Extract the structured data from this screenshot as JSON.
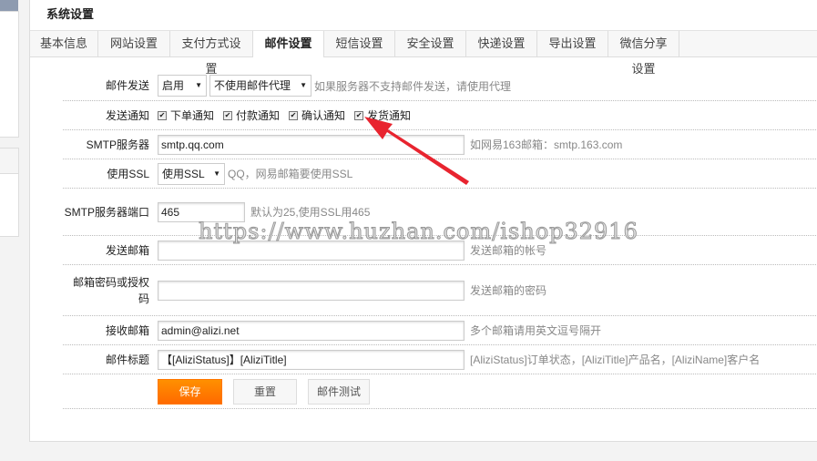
{
  "page_title": "系统设置",
  "tabs": [
    "基本信息",
    "网站设置",
    "支付方式设置",
    "邮件设置",
    "短信设置",
    "安全设置",
    "快递设置",
    "导出设置",
    "微信分享设置"
  ],
  "form": {
    "mail_send": {
      "label": "邮件发送",
      "status": "启用",
      "proxy": "不使用邮件代理",
      "hint": "如果服务器不支持邮件发送，请使用代理"
    },
    "notify": {
      "label": "发送通知",
      "options": [
        "下单通知",
        "付款通知",
        "确认通知",
        "发货通知"
      ]
    },
    "smtp_server": {
      "label": "SMTP服务器",
      "value": "smtp.qq.com",
      "hint": "如网易163邮箱：smtp.163.com"
    },
    "ssl": {
      "label": "使用SSL",
      "value": "使用SSL",
      "hint": "QQ，网易邮箱要使用SSL"
    },
    "smtp_port": {
      "label": "SMTP服务器端口",
      "value": "465",
      "hint": "默认为25,使用SSL用465"
    },
    "sender": {
      "label": "发送邮箱",
      "value": "",
      "hint": "发送邮箱的帐号"
    },
    "password": {
      "label": "邮箱密码或授权码",
      "value": "",
      "hint": "发送邮箱的密码"
    },
    "receiver": {
      "label": "接收邮箱",
      "value": "admin@alizi.net",
      "hint": "多个邮箱请用英文逗号隔开"
    },
    "subject": {
      "label": "邮件标题",
      "value": "【[AliziStatus]】[AliziTitle]",
      "hint": "[AliziStatus]订单状态，[AliziTitle]产品名，[AliziName]客户名"
    }
  },
  "buttons": {
    "save": "保存",
    "reset": "重置",
    "test": "邮件测试"
  },
  "watermark": "https://www.huzhan.com/ishop32916",
  "colors": {
    "save": "#ff7a00",
    "arrow": "#e8242f"
  }
}
